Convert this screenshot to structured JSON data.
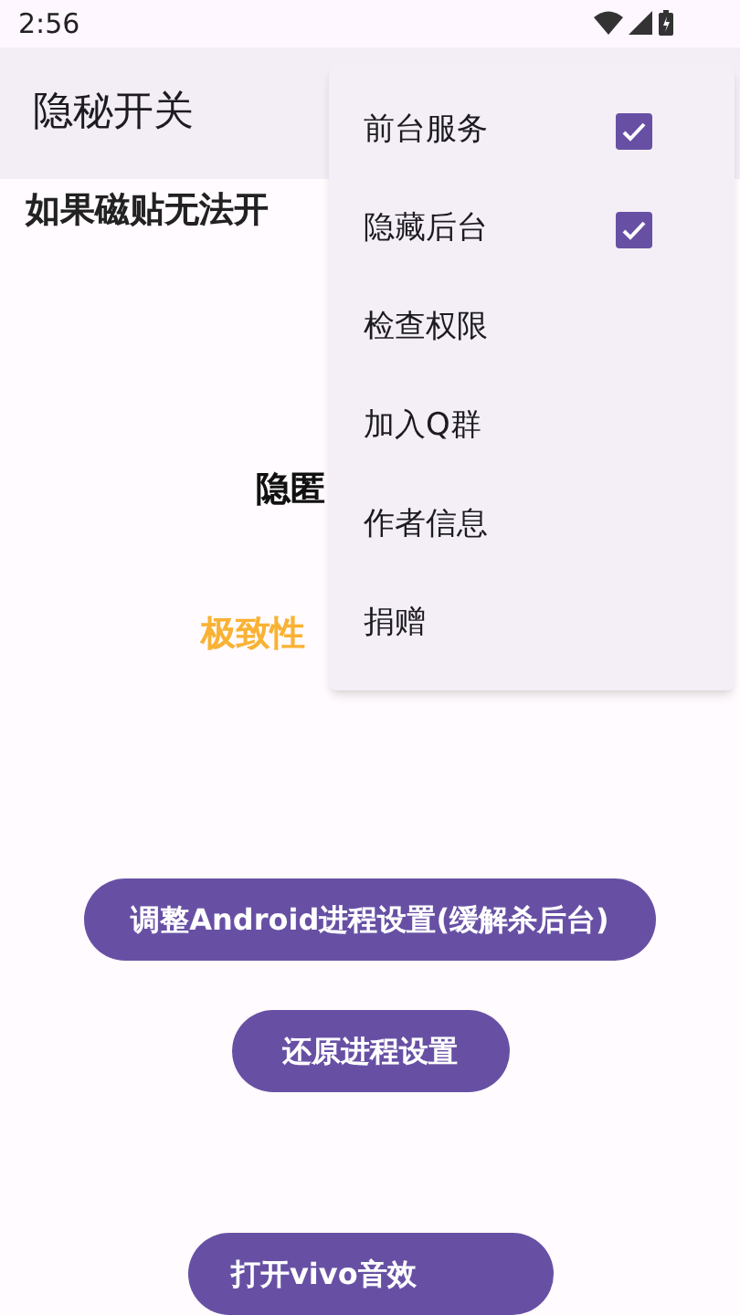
{
  "status_bar": {
    "time": "2:56"
  },
  "app_bar": {
    "title": "隐秘开关"
  },
  "content": {
    "notice": "如果磁贴无法开",
    "heading": "隐匿",
    "highlight": "极致性"
  },
  "buttons": [
    {
      "label": "调整Android进程设置(缓解杀后台)"
    },
    {
      "label": "还原进程设置"
    },
    {
      "label": "打开vivo音效"
    }
  ],
  "menu": {
    "items": [
      {
        "label": "前台服务",
        "kind": "checkbox",
        "checked": true
      },
      {
        "label": "隐藏后台",
        "kind": "checkbox",
        "checked": true
      },
      {
        "label": "检查权限",
        "kind": "plain"
      },
      {
        "label": "加入Q群",
        "kind": "plain"
      },
      {
        "label": "作者信息",
        "kind": "plain"
      },
      {
        "label": "捐赠",
        "kind": "plain"
      }
    ]
  }
}
